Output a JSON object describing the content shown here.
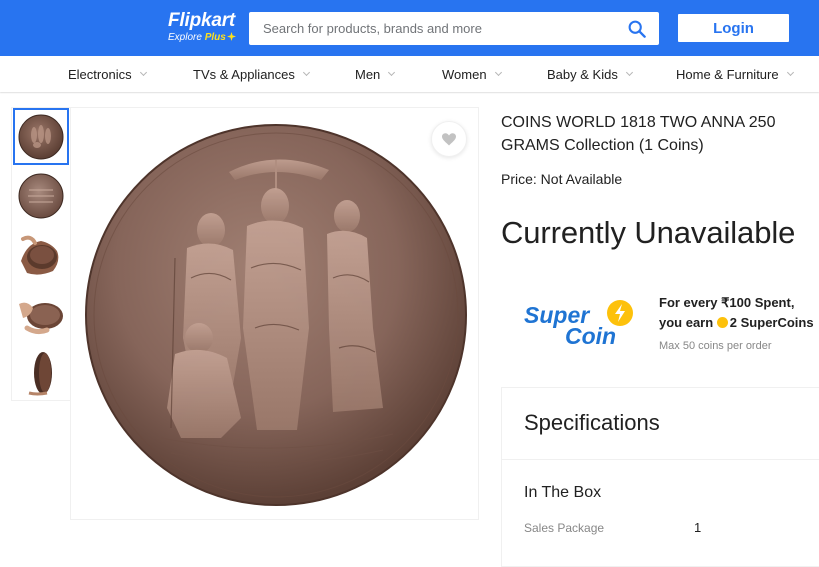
{
  "brand": {
    "name": "Flipkart",
    "sub_prefix": "Explore ",
    "sub_plus": "Plus",
    "colors": {
      "primary": "#2874f0",
      "plus_accent": "#ffe11b",
      "supercoin_blue": "#1f74d3",
      "supercoin_yellow": "#fdc10b"
    }
  },
  "search": {
    "placeholder": "Search for products, brands and more",
    "value": "",
    "icon": "magnifier-icon"
  },
  "login_label": "Login",
  "categories": [
    "Electronics",
    "TVs & Appliances",
    "Men",
    "Women",
    "Baby & Kids",
    "Home & Furniture"
  ],
  "gallery": {
    "thumbnails": [
      "coin-front-thumb",
      "coin-back-thumb",
      "coin-in-hand-thumb",
      "coin-held-thumb",
      "coin-edge-thumb"
    ],
    "selected_index": 0
  },
  "wishlist_icon": "heart-icon",
  "product": {
    "title": "COINS WORLD 1818 TWO ANNA 250 GRAMS Collection  (1 Coins)",
    "price": "Price: Not Available",
    "availability": "Currently Unavailable"
  },
  "supercoin": {
    "logo_line1": "Super",
    "logo_line2": "Coin",
    "offer_line1": "For every ₹100 Spent,",
    "offer_line2_prefix": "you earn ",
    "offer_line2_coins": "2 SuperCoins",
    "max_note": "Max 50 coins per order"
  },
  "specifications": {
    "heading": "Specifications",
    "section": "In The Box",
    "rows": [
      {
        "label": "Sales Package",
        "value": "1"
      }
    ]
  }
}
